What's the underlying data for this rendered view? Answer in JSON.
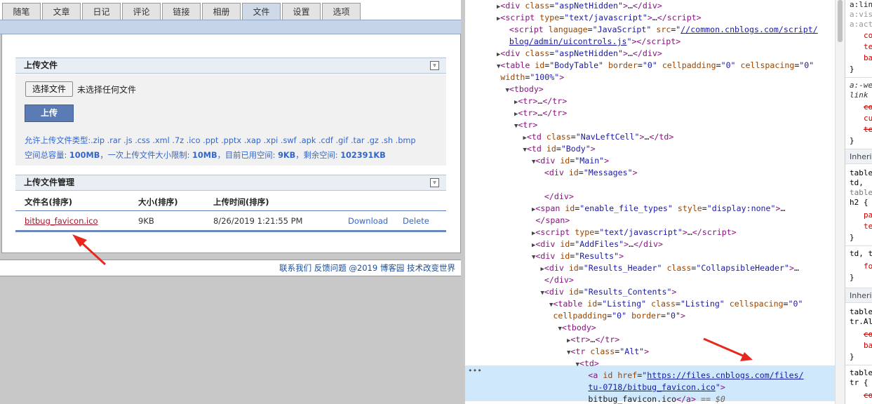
{
  "tabs": [
    "随笔",
    "文章",
    "日记",
    "评论",
    "链接",
    "相册",
    "文件",
    "设置",
    "选项"
  ],
  "upload_section": {
    "title": "上传文件",
    "choose_button": "选择文件",
    "no_file_text": "未选择任何文件",
    "upload_button": "上传",
    "allowed_types": "允许上传文件类型:.zip .rar .js .css .xml .7z .ico .ppt .pptx .xap .xpi .swf .apk .cdf .gif .tar .gz .sh .bmp",
    "quota_prefix": "空间总容量: ",
    "quota_total": "100MB",
    "quota_mid1": "，一次上传文件大小限制: ",
    "quota_limit": "10MB",
    "quota_mid2": "，目前已用空间: ",
    "quota_used": "9KB",
    "quota_mid3": "，剩余空间: ",
    "quota_free": "102391KB"
  },
  "manage_section": {
    "title": "上传文件管理",
    "columns": [
      "文件名(排序)",
      "大小(排序)",
      "上传时间(排序)"
    ],
    "rows": [
      {
        "name": "bitbug_favicon.ico",
        "size": "9KB",
        "time": "8/26/2019 1:21:55 PM",
        "download": "Download",
        "delete": "Delete"
      }
    ]
  },
  "footer": "联系我们 反馈问题 @2019 博客园  技术改变世界",
  "devtools": {
    "lines": [
      {
        "indent": 4,
        "tri": "▶",
        "html": "<span class=\"tag\">&lt;div</span> <span class=\"attr\">class</span>=<span class=\"val\">\"aspNetHidden\"</span><span class=\"tag\">&gt;</span>…<span class=\"tag\">&lt;/div&gt;</span>"
      },
      {
        "indent": 4,
        "tri": "▶",
        "html": "<span class=\"tag\">&lt;script</span> <span class=\"attr\">type</span>=<span class=\"val\">\"text/javascript\"</span><span class=\"tag\">&gt;</span>…<span class=\"tag\">&lt;/script&gt;</span>"
      },
      {
        "indent": 5,
        "tri": "",
        "html": "<span class=\"tag\">&lt;script</span> <span class=\"attr\">language</span>=<span class=\"val\">\"JavaScript\"</span> <span class=\"attr\">src</span>=<span class=\"val\">\"</span><span class=\"lnk\">//common.cnblogs.com/script/</span>"
      },
      {
        "indent": 5,
        "tri": "",
        "html": "<span class=\"lnk\">blog/admin/uicontrols.js</span><span class=\"val\">\"</span><span class=\"tag\">&gt;&lt;/script&gt;</span>"
      },
      {
        "indent": 4,
        "tri": "▶",
        "html": "<span class=\"tag\">&lt;div</span> <span class=\"attr\">class</span>=<span class=\"val\">\"aspNetHidden\"</span><span class=\"tag\">&gt;</span>…<span class=\"tag\">&lt;/div&gt;</span>"
      },
      {
        "indent": 4,
        "tri": "▼",
        "html": "<span class=\"tag\">&lt;table</span> <span class=\"attr\">id</span>=<span class=\"val\">\"BodyTable\"</span> <span class=\"attr\">border</span>=<span class=\"val\">\"0\"</span> <span class=\"attr\">cellpadding</span>=<span class=\"val\">\"0\"</span> <span class=\"attr\">cellspacing</span>=<span class=\"val\">\"0\"</span>"
      },
      {
        "indent": 4,
        "tri": "",
        "html": "<span class=\"attr\">width</span>=<span class=\"val\">\"100%\"</span><span class=\"tag\">&gt;</span>"
      },
      {
        "indent": 5,
        "tri": "▼",
        "html": "<span class=\"tag\">&lt;tbody&gt;</span>"
      },
      {
        "indent": 6,
        "tri": "▶",
        "html": "<span class=\"tag\">&lt;tr&gt;</span>…<span class=\"tag\">&lt;/tr&gt;</span>"
      },
      {
        "indent": 6,
        "tri": "▶",
        "html": "<span class=\"tag\">&lt;tr&gt;</span>…<span class=\"tag\">&lt;/tr&gt;</span>"
      },
      {
        "indent": 6,
        "tri": "▼",
        "html": "<span class=\"tag\">&lt;tr&gt;</span>"
      },
      {
        "indent": 7,
        "tri": "▶",
        "html": "<span class=\"tag\">&lt;td</span> <span class=\"attr\">class</span>=<span class=\"val\">\"NavLeftCell\"</span><span class=\"tag\">&gt;</span>…<span class=\"tag\">&lt;/td&gt;</span>"
      },
      {
        "indent": 7,
        "tri": "▼",
        "html": "<span class=\"tag\">&lt;td</span> <span class=\"attr\">id</span>=<span class=\"val\">\"Body\"</span><span class=\"tag\">&gt;</span>"
      },
      {
        "indent": 8,
        "tri": "▼",
        "html": "<span class=\"tag\">&lt;div</span> <span class=\"attr\">id</span>=<span class=\"val\">\"Main\"</span><span class=\"tag\">&gt;</span>"
      },
      {
        "indent": 9,
        "tri": "",
        "html": "<span class=\"tag\">&lt;div</span> <span class=\"attr\">id</span>=<span class=\"val\">\"Messages\"</span><span class=\"tag\">&gt;</span>"
      },
      {
        "indent": 9,
        "tri": "",
        "html": ""
      },
      {
        "indent": 9,
        "tri": "",
        "html": "<span class=\"tag\">&lt;/div&gt;</span>"
      },
      {
        "indent": 8,
        "tri": "▶",
        "html": "<span class=\"tag\">&lt;span</span> <span class=\"attr\">id</span>=<span class=\"val\">\"enable_file_types\"</span> <span class=\"attr\">style</span>=<span class=\"val\">\"display:none\"</span><span class=\"tag\">&gt;</span>…"
      },
      {
        "indent": 8,
        "tri": "",
        "html": "<span class=\"tag\">&lt;/span&gt;</span>"
      },
      {
        "indent": 8,
        "tri": "▶",
        "html": "<span class=\"tag\">&lt;script</span> <span class=\"attr\">type</span>=<span class=\"val\">\"text/javascript\"</span><span class=\"tag\">&gt;</span>…<span class=\"tag\">&lt;/script&gt;</span>"
      },
      {
        "indent": 8,
        "tri": "▶",
        "html": "<span class=\"tag\">&lt;div</span> <span class=\"attr\">id</span>=<span class=\"val\">\"AddFiles\"</span><span class=\"tag\">&gt;</span>…<span class=\"tag\">&lt;/div&gt;</span>"
      },
      {
        "indent": 8,
        "tri": "▼",
        "html": "<span class=\"tag\">&lt;div</span> <span class=\"attr\">id</span>=<span class=\"val\">\"Results\"</span><span class=\"tag\">&gt;</span>"
      },
      {
        "indent": 9,
        "tri": "▶",
        "html": "<span class=\"tag\">&lt;div</span> <span class=\"attr\">id</span>=<span class=\"val\">\"Results_Header\"</span> <span class=\"attr\">class</span>=<span class=\"val\">\"CollapsibleHeader\"</span><span class=\"tag\">&gt;</span>…"
      },
      {
        "indent": 9,
        "tri": "",
        "html": "<span class=\"tag\">&lt;/div&gt;</span>"
      },
      {
        "indent": 9,
        "tri": "▼",
        "html": "<span class=\"tag\">&lt;div</span> <span class=\"attr\">id</span>=<span class=\"val\">\"Results_Contents\"</span><span class=\"tag\">&gt;</span>"
      },
      {
        "indent": 10,
        "tri": "▼",
        "html": "<span class=\"tag\">&lt;table</span> <span class=\"attr\">id</span>=<span class=\"val\">\"Listing\"</span> <span class=\"attr\">class</span>=<span class=\"val\">\"Listing\"</span> <span class=\"attr\">cellspacing</span>=<span class=\"val\">\"0\"</span>"
      },
      {
        "indent": 10,
        "tri": "",
        "html": "<span class=\"attr\">cellpadding</span>=<span class=\"val\">\"0\"</span> <span class=\"attr\">border</span>=<span class=\"val\">\"0\"</span><span class=\"tag\">&gt;</span>"
      },
      {
        "indent": 11,
        "tri": "▼",
        "html": "<span class=\"tag\">&lt;tbody&gt;</span>"
      },
      {
        "indent": 12,
        "tri": "▶",
        "html": "<span class=\"tag\">&lt;tr&gt;</span>…<span class=\"tag\">&lt;/tr&gt;</span>"
      },
      {
        "indent": 12,
        "tri": "▼",
        "html": "<span class=\"tag\">&lt;tr</span> <span class=\"attr\">class</span>=<span class=\"val\">\"Alt\"</span><span class=\"tag\">&gt;</span>"
      },
      {
        "indent": 13,
        "tri": "▼",
        "html": "<span class=\"tag\">&lt;td&gt;</span>"
      },
      {
        "indent": 14,
        "tri": "",
        "html": "<span class=\"tag\">&lt;a</span> <span class=\"attr\">id</span> <span class=\"attr\">href</span>=<span class=\"val\">\"</span><span class=\"lnk\">https://files.cnblogs.com/files/</span>"
      },
      {
        "indent": 14,
        "tri": "",
        "html": "<span class=\"lnk\">tu-0718/bitbug_favicon.ico</span><span class=\"val\">\"</span><span class=\"tag\">&gt;</span>"
      },
      {
        "indent": 14,
        "tri": "",
        "html": "bitbug_favicon.ico<span class=\"tag\">&lt;/a&gt;</span> <span class=\"dim\">== <i>$0</i></span>"
      }
    ]
  },
  "styles_pane": {
    "inherited_label": "Inheri"
  },
  "colors": {
    "tab_active": "#cfd9e8",
    "header_bar": "#c6d4ea",
    "link_red": "#a3172b",
    "link_blue": "#3366cc",
    "upload_button": "#5b7bb4",
    "arrow": "#e8281e",
    "devtools_selected": "#cfe8fc"
  }
}
